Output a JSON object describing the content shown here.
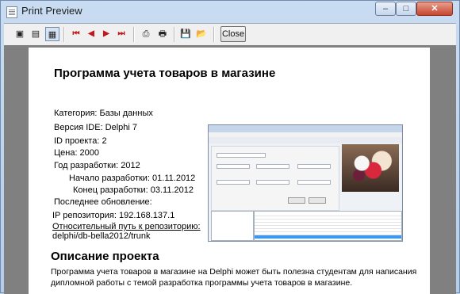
{
  "window": {
    "title": "Print Preview",
    "min_label": "–",
    "max_label": "□",
    "close_label": "✕"
  },
  "toolbar": {
    "icons": [
      {
        "name": "fit-page-icon",
        "glyph": "▣"
      },
      {
        "name": "page-width-icon",
        "glyph": "▤"
      },
      {
        "name": "multi-page-icon",
        "glyph": "▦"
      },
      {
        "name": "first-page-icon",
        "glyph": "⏮"
      },
      {
        "name": "prev-page-icon",
        "glyph": "◀"
      },
      {
        "name": "next-page-icon",
        "glyph": "▶"
      },
      {
        "name": "last-page-icon",
        "glyph": "⏭"
      },
      {
        "name": "print-setup-icon",
        "glyph": "⎙"
      },
      {
        "name": "print-icon",
        "glyph": "🖶"
      },
      {
        "name": "save-icon",
        "glyph": "💾"
      },
      {
        "name": "open-icon",
        "glyph": "📂"
      }
    ],
    "close_label": "Close"
  },
  "page": {
    "title": "Программа учета товаров в магазине",
    "fields": {
      "category": "Категория:  Базы данных",
      "ide": "Версия IDE:  Delphi 7",
      "project_id": "ID проекта:  2",
      "price": "Цена:  2000",
      "year": "Год разработки:  2012",
      "start": "Начало разработки: 01.11.2012",
      "end": "Конец разработки:  03.11.2012",
      "last_update": "Последнее обновление:",
      "repo": "IP репозитория:   192.168.137.1",
      "repo_path_label": "Относительный путь к репозиторию:",
      "repo_path": "delphi/db-bella2012/trunk"
    },
    "section_title": "Описание проекта",
    "description": "Программа учета товаров в магазине на Delphi может быть полезна студентам для написания дипломной работы с темой разработка программы учета товаров в магазине."
  },
  "colors": {
    "nav_red": "#c0181b",
    "page_bg": "#ffffff",
    "viewport_bg": "#808080",
    "selection": "#3399ff"
  }
}
